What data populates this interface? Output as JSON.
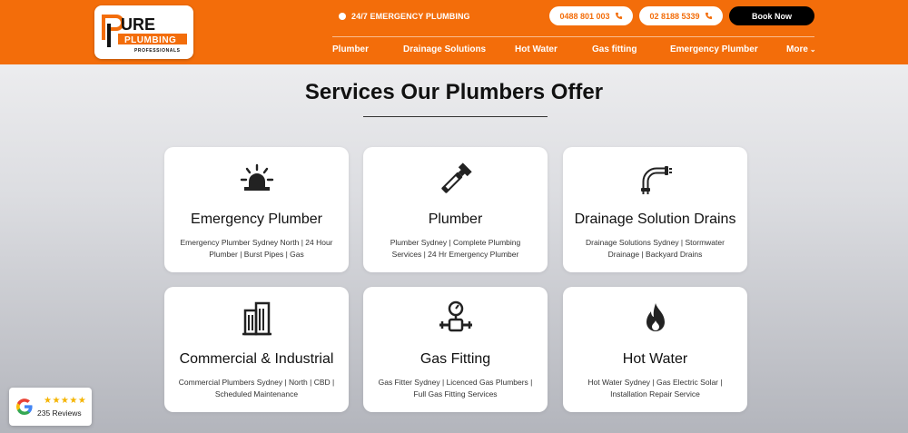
{
  "colors": {
    "brand": "#f36d0a",
    "dark": "#000000",
    "text": "#111111",
    "star": "#f5b400"
  },
  "header": {
    "logo": {
      "line1": "URE",
      "line2": "PLUMBING",
      "line3": "PROFESSIONALS"
    },
    "emergency_label": "24/7 EMERGENCY PLUMBING",
    "phone1": "0488 801 003",
    "phone2": "02 8188 5339",
    "book_label": "Book Now",
    "nav": [
      {
        "label": "Plumber"
      },
      {
        "label": "Drainage Solutions"
      },
      {
        "label": "Hot Water"
      },
      {
        "label": "Gas fitting"
      },
      {
        "label": "Emergency Plumber"
      },
      {
        "label": "More"
      }
    ]
  },
  "main": {
    "title": "Services Our Plumbers Offer",
    "cards": [
      {
        "icon": "siren-icon",
        "title": "Emergency Plumber",
        "desc": "Emergency Plumber Sydney North | 24 Hour Plumber | Burst Pipes | Gas"
      },
      {
        "icon": "wrench-icon",
        "title": "Plumber",
        "desc": "Plumber Sydney | Complete Plumbing Services | 24 Hr Emergency Plumber"
      },
      {
        "icon": "pipe-icon",
        "title": "Drainage Solution Drains",
        "desc": "Drainage Solutions Sydney | Stormwater Drainage | Backyard Drains"
      },
      {
        "icon": "building-icon",
        "title": "Commercial & Industrial",
        "desc": "Commercial Plumbers Sydney | North | CBD | Scheduled Maintenance"
      },
      {
        "icon": "gauge-icon",
        "title": "Gas Fitting",
        "desc": "Gas Fitter Sydney | Licenced Gas Plumbers | Full Gas Fitting Services"
      },
      {
        "icon": "flame-icon",
        "title": "Hot Water",
        "desc": "Hot Water Sydney | Gas Electric Solar | Installation Repair Service"
      }
    ]
  },
  "reviews": {
    "stars": "★★★★★",
    "count_label": "235 Reviews",
    "rating_stars": 5
  }
}
